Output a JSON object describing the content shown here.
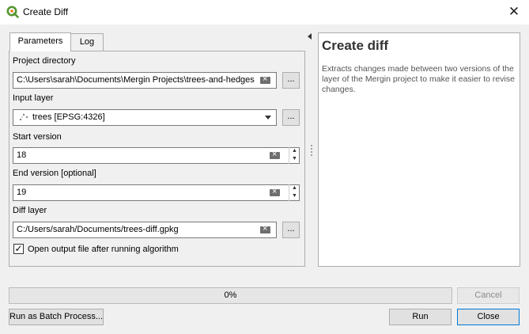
{
  "window": {
    "title": "Create Diff",
    "close_glyph": "✕",
    "app_icon": "qgis-logo-icon",
    "brand_color": "#589632"
  },
  "tabs": [
    {
      "label": "Parameters",
      "active": true
    },
    {
      "label": "Log",
      "active": false
    }
  ],
  "form": {
    "project_directory": {
      "label": "Project directory",
      "value": "C:\\Users\\sarah\\Documents\\Mergin Projects\\trees-and-hedges",
      "browse": "..."
    },
    "input_layer": {
      "label": "Input layer",
      "value": "trees [EPSG:4326]",
      "icon": "point-layer-icon",
      "browse": "..."
    },
    "start_version": {
      "label": "Start version",
      "value": "18"
    },
    "end_version": {
      "label": "End version [optional]",
      "value": "19"
    },
    "diff_layer": {
      "label": "Diff layer",
      "value": "C:/Users/sarah/Documents/trees-diff.gpkg",
      "browse": "..."
    },
    "open_output": {
      "label": "Open output file after running algorithm",
      "checked": true,
      "check_glyph": "✓"
    }
  },
  "help": {
    "title": "Create diff",
    "description": "Extracts changes made between two versions of the layer of the Mergin project to make it easier to revise changes."
  },
  "progress": {
    "value": 0,
    "text": "0%"
  },
  "buttons": {
    "cancel": "Cancel",
    "batch": "Run as Batch Process...",
    "run": "Run",
    "close": "Close"
  },
  "spin_glyphs": {
    "up": "▲",
    "down": "▼"
  }
}
